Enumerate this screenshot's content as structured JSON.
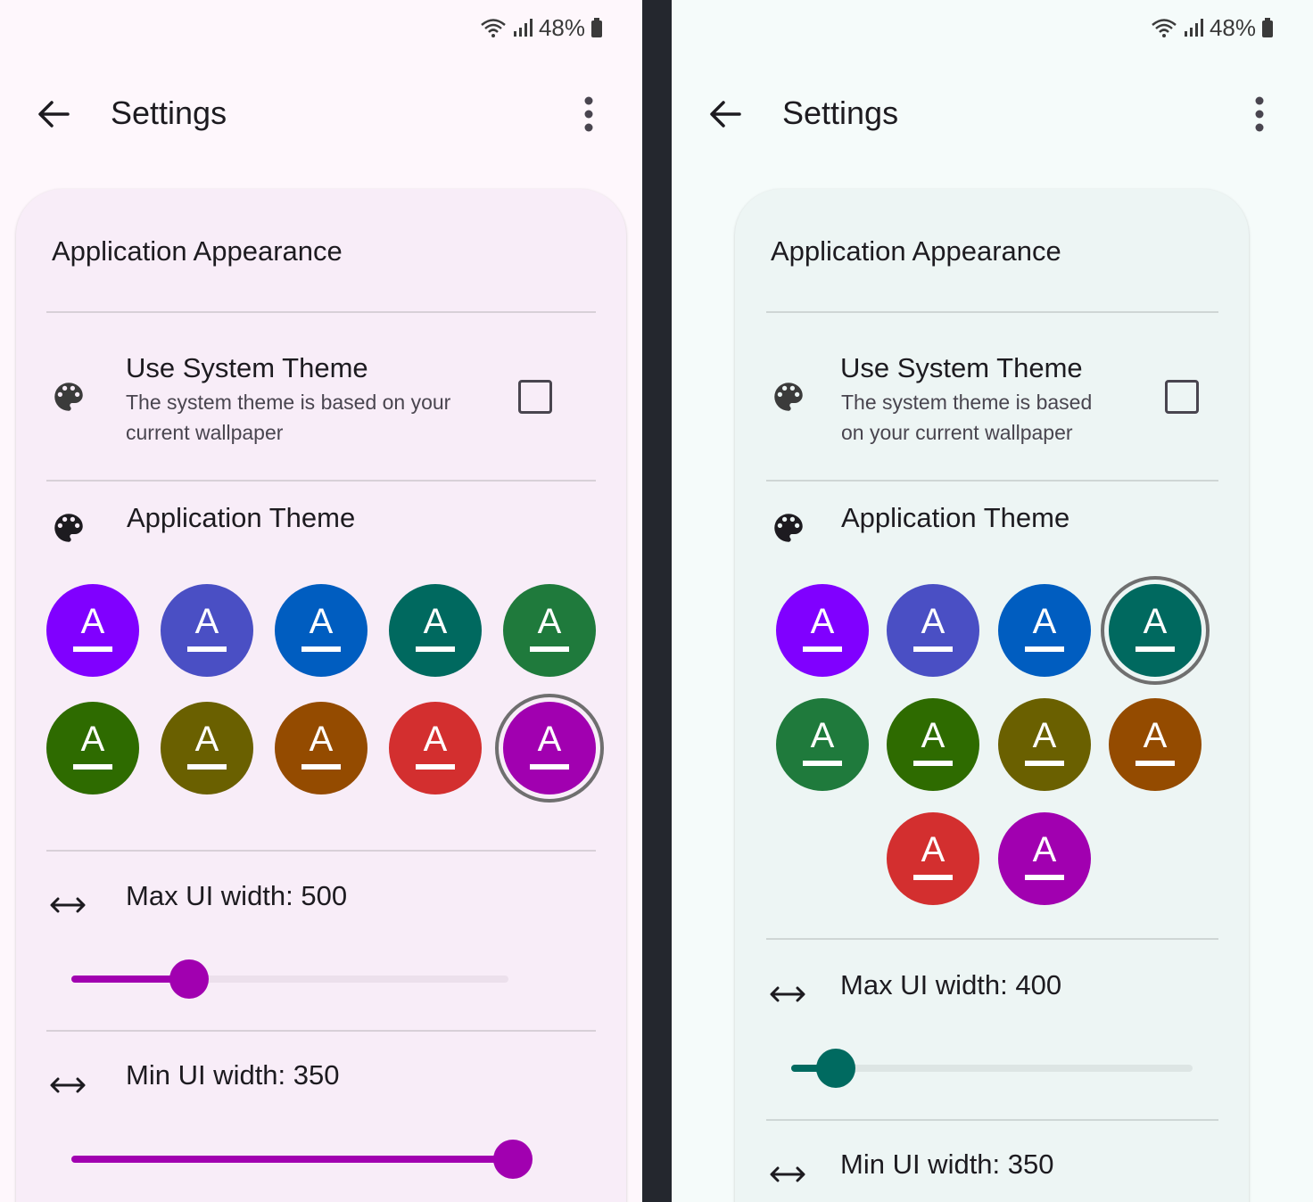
{
  "colors": {
    "left_accent": "#a100b0",
    "right_accent": "#006a60",
    "track_left": "#ece0ec",
    "track_right": "#dde5e4"
  },
  "left": {
    "status": {
      "battery": "48%"
    },
    "topbar": {
      "title": "Settings"
    },
    "card": {
      "section_title": "Application Appearance",
      "system_theme": {
        "title": "Use System Theme",
        "subtitle_line1": "The system theme is based on your",
        "subtitle_line2": "current wallpaper",
        "checked": false
      },
      "app_theme": {
        "title": "Application Theme",
        "selected_index": 9
      },
      "swatches": [
        {
          "color": "#8000ff",
          "glyph": "A"
        },
        {
          "color": "#4a4fc4",
          "glyph": "A"
        },
        {
          "color": "#005dc0",
          "glyph": "A"
        },
        {
          "color": "#00695f",
          "glyph": "A"
        },
        {
          "color": "#1f7a3c",
          "glyph": "A"
        },
        {
          "color": "#2e6b00",
          "glyph": "A"
        },
        {
          "color": "#6a6000",
          "glyph": "A"
        },
        {
          "color": "#944b00",
          "glyph": "A"
        },
        {
          "color": "#d32f2f",
          "glyph": "A"
        },
        {
          "color": "#a100b0",
          "glyph": "A"
        }
      ],
      "max_width": {
        "label": "Max UI width: 500",
        "fraction": 0.27
      },
      "min_width": {
        "label": "Min UI width: 350",
        "fraction": 0.97
      }
    }
  },
  "right": {
    "status": {
      "battery": "48%"
    },
    "topbar": {
      "title": "Settings"
    },
    "card": {
      "section_title": "Application Appearance",
      "system_theme": {
        "title": "Use System Theme",
        "subtitle_line1": "The system theme is based",
        "subtitle_line2": "on your current wallpaper",
        "checked": false
      },
      "app_theme": {
        "title": "Application Theme",
        "selected_index": 3
      },
      "swatches": [
        {
          "color": "#8000ff",
          "glyph": "A"
        },
        {
          "color": "#4a4fc4",
          "glyph": "A"
        },
        {
          "color": "#005dc0",
          "glyph": "A"
        },
        {
          "color": "#00695f",
          "glyph": "A"
        },
        {
          "color": "#1f7a3c",
          "glyph": "A"
        },
        {
          "color": "#2e6b00",
          "glyph": "A"
        },
        {
          "color": "#6a6000",
          "glyph": "A"
        },
        {
          "color": "#944b00",
          "glyph": "A"
        },
        {
          "color": "#d32f2f",
          "glyph": "A"
        },
        {
          "color": "#a100b0",
          "glyph": "A"
        }
      ],
      "max_width": {
        "label": "Max UI width: 400",
        "fraction": 0.11
      },
      "min_width": {
        "label": "Min UI width: 350"
      }
    }
  }
}
